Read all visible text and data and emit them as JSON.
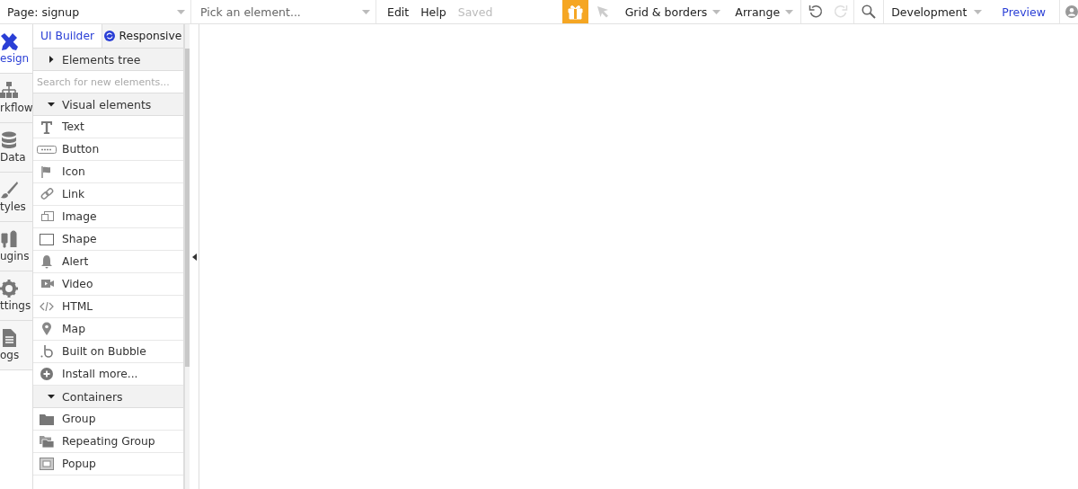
{
  "topbar": {
    "page_select": "Page: signup",
    "element_select": {
      "placeholder": "Pick an element..."
    },
    "menu": [
      {
        "label": "Edit",
        "disabled": false
      },
      {
        "label": "Help",
        "disabled": false
      },
      {
        "label": "Saved",
        "disabled": true
      }
    ],
    "grid_menu": "Grid & borders",
    "arrange_menu": "Arrange",
    "undo": {
      "disabled": false
    },
    "redo": {
      "disabled": true
    },
    "environment": "Development",
    "preview": "Preview"
  },
  "sidenav": {
    "items": [
      {
        "label": "esign",
        "kind": "design",
        "selected": true
      },
      {
        "label": "rkflow",
        "kind": "workflow",
        "selected": false
      },
      {
        "label": "Data",
        "kind": "data",
        "selected": false
      },
      {
        "label": "tyles",
        "kind": "styles",
        "selected": false
      },
      {
        "label": "ugins",
        "kind": "plugins",
        "selected": false
      },
      {
        "label": "ttings",
        "kind": "settings",
        "selected": false
      },
      {
        "label": "ogs",
        "kind": "logs",
        "selected": false
      }
    ]
  },
  "panel": {
    "tabs": [
      {
        "label": "UI Builder",
        "selected": true
      },
      {
        "label": "Responsive",
        "selected": false
      }
    ],
    "tree": {
      "label": "Elements tree",
      "expanded": false
    },
    "search": {
      "placeholder": "Search for new elements..."
    },
    "sections": [
      {
        "label": "Visual elements",
        "expanded": true,
        "items": [
          {
            "label": "Text",
            "kind": "text"
          },
          {
            "label": "Button",
            "kind": "button"
          },
          {
            "label": "Icon",
            "kind": "flag"
          },
          {
            "label": "Link",
            "kind": "link"
          },
          {
            "label": "Image",
            "kind": "image"
          },
          {
            "label": "Shape",
            "kind": "shape"
          },
          {
            "label": "Alert",
            "kind": "bell"
          },
          {
            "label": "Video",
            "kind": "video"
          },
          {
            "label": "HTML",
            "kind": "code"
          },
          {
            "label": "Map",
            "kind": "pin"
          },
          {
            "label": "Built on Bubble",
            "kind": "bubble"
          },
          {
            "label": "Install more...",
            "kind": "plus"
          }
        ]
      },
      {
        "label": "Containers",
        "expanded": true,
        "items": [
          {
            "label": "Group",
            "kind": "folder"
          },
          {
            "label": "Repeating Group",
            "kind": "folders"
          },
          {
            "label": "Popup",
            "kind": "popup"
          }
        ]
      }
    ]
  }
}
